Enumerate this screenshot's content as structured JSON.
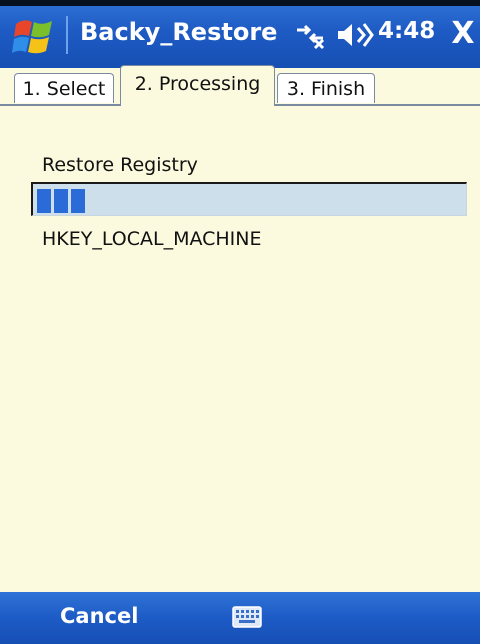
{
  "window": {
    "title": "Backy_Restore",
    "clock": "4:48",
    "close_label": "X"
  },
  "tabs": [
    {
      "label": "1. Select"
    },
    {
      "label": "2. Processing"
    },
    {
      "label": "3. Finish"
    }
  ],
  "main": {
    "section_label": "Restore Registry",
    "status_text": "HKEY_LOCAL_MACHINE",
    "progress": {
      "percent": 15
    }
  },
  "menubar": {
    "cancel_label": "Cancel"
  },
  "colors": {
    "accent": "#1e5bc4",
    "content_bg": "#fcfade",
    "progress_fill": "#2b6bd8"
  },
  "icons": {
    "start": "windows-logo-icon",
    "connectivity": "connectivity-icon",
    "speaker": "speaker-icon",
    "keyboard": "keyboard-icon"
  }
}
